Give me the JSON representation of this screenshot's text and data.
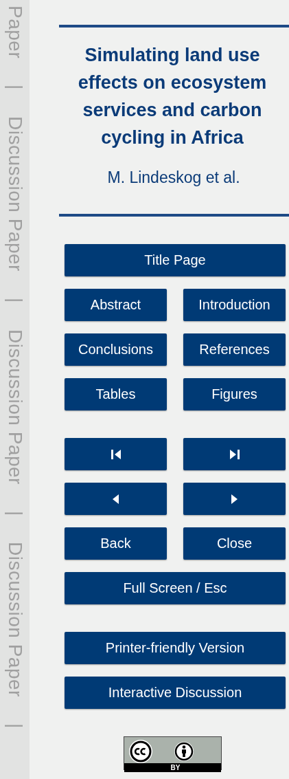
{
  "margin_labels": [
    "Paper",
    "|",
    "Discussion Paper",
    "|",
    "Discussion Paper",
    "|",
    "Discussion Paper",
    "|"
  ],
  "title": "Simulating land use effects on ecosystem services and carbon cycling in Africa",
  "authors": "M. Lindeskog et al.",
  "nav_groups": [
    {
      "rows": [
        [
          {
            "kind": "text",
            "label": "Title Page"
          }
        ],
        [
          {
            "kind": "text",
            "label": "Abstract"
          },
          {
            "kind": "text",
            "label": "Introduction"
          }
        ],
        [
          {
            "kind": "text",
            "label": "Conclusions"
          },
          {
            "kind": "text",
            "label": "References"
          }
        ],
        [
          {
            "kind": "text",
            "label": "Tables"
          },
          {
            "kind": "text",
            "label": "Figures"
          }
        ]
      ]
    },
    {
      "rows": [
        [
          {
            "kind": "first-page"
          },
          {
            "kind": "last-page"
          }
        ],
        [
          {
            "kind": "prev-page"
          },
          {
            "kind": "next-page"
          }
        ],
        [
          {
            "kind": "text",
            "label": "Back"
          },
          {
            "kind": "text",
            "label": "Close"
          }
        ],
        [
          {
            "kind": "text",
            "label": "Full Screen / Esc"
          }
        ]
      ]
    },
    {
      "rows": [
        [
          {
            "kind": "text",
            "label": "Printer-friendly Version"
          }
        ],
        [
          {
            "kind": "text",
            "label": "Interactive Discussion"
          }
        ]
      ]
    }
  ],
  "license": {
    "label": "BY"
  }
}
